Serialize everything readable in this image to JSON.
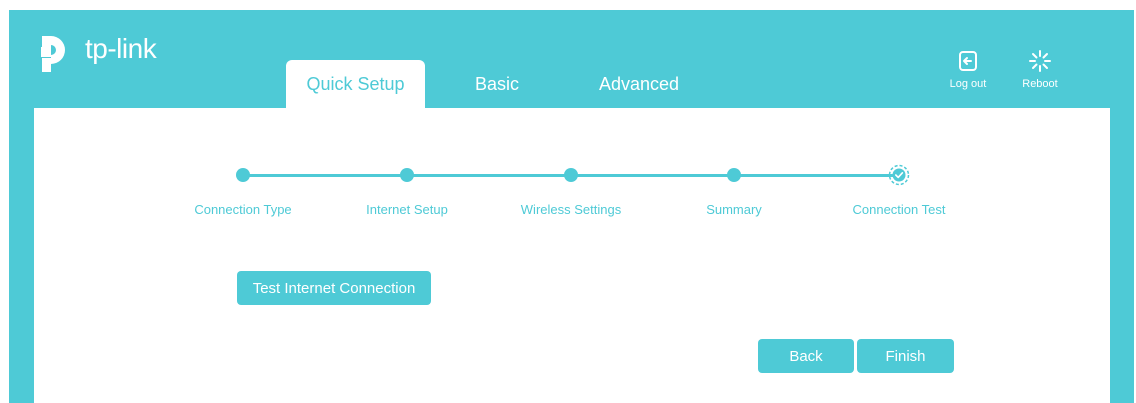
{
  "brand": {
    "name": "tp-link",
    "accent": "#4ecad6"
  },
  "tabs": [
    {
      "label": "Quick Setup",
      "active": true
    },
    {
      "label": "Basic",
      "active": false
    },
    {
      "label": "Advanced",
      "active": false
    }
  ],
  "header_actions": {
    "logout": {
      "label": "Log out",
      "icon": "logout-icon"
    },
    "reboot": {
      "label": "Reboot",
      "icon": "reboot-icon"
    }
  },
  "steps": [
    {
      "label": "Connection Type",
      "state": "done"
    },
    {
      "label": "Internet Setup",
      "state": "done"
    },
    {
      "label": "Wireless Settings",
      "state": "done"
    },
    {
      "label": "Summary",
      "state": "done"
    },
    {
      "label": "Connection Test",
      "state": "current"
    }
  ],
  "actions": {
    "test_connection": "Test Internet Connection",
    "back": "Back",
    "finish": "Finish"
  }
}
